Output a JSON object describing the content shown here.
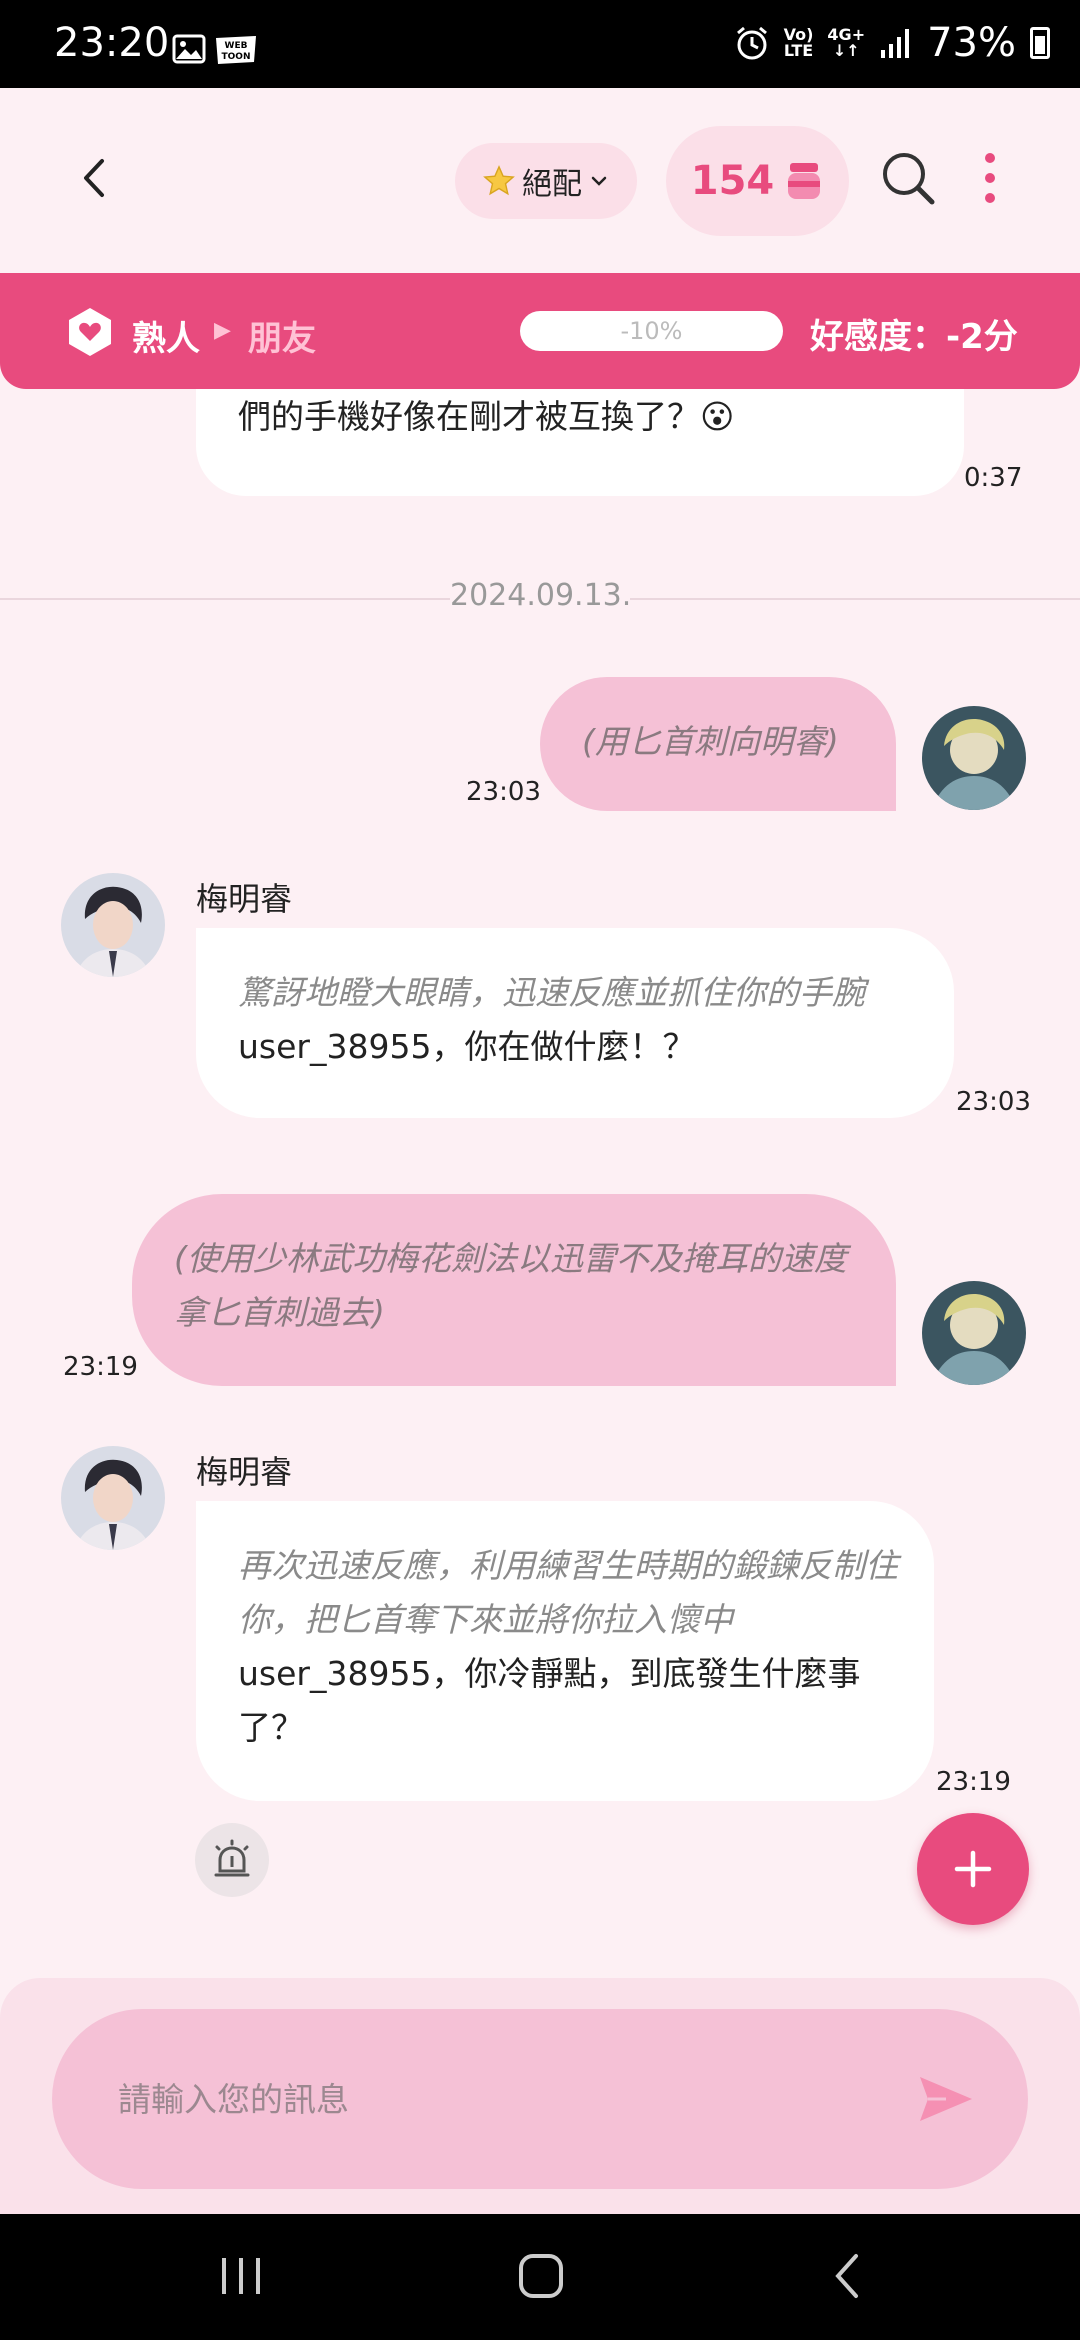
{
  "status_bar": {
    "time": "23:20",
    "network_top": "Vo)",
    "network_bottom": "LTE",
    "mobile_top": "4G+",
    "battery": "73%"
  },
  "header": {
    "match_label": "絕配",
    "coin_count": "154"
  },
  "relationship": {
    "from": "熟人",
    "to": "朋友",
    "progress_label": "-10%",
    "affinity": "好感度：-2分"
  },
  "colors": {
    "accent": "#e84b7e",
    "bubble_me": "#f5c1d6",
    "background": "#fdf0f4"
  },
  "messages": [
    {
      "sender": "",
      "partial_text": "們的手機好像在剛才被互換了？",
      "emoji": "😮",
      "time": "0:37"
    },
    {
      "date_separator": "2024.09.13."
    },
    {
      "sender": "me",
      "text": "(用匕首刺向明睿)",
      "time": "23:03"
    },
    {
      "sender": "梅明睿",
      "action": "驚訝地瞪大眼睛，迅速反應並抓住你的手腕",
      "text": "user_38955，你在做什麼！？",
      "time": "23:03"
    },
    {
      "sender": "me",
      "text": "(使用少林武功梅花劍法以迅雷不及掩耳的速度拿匕首刺過去)",
      "time": "23:19"
    },
    {
      "sender": "梅明睿",
      "action": "再次迅速反應，利用練習生時期的鍛鍊反制住你，把匕首奪下來並將你拉入懷中",
      "text": "user_38955，你冷靜點，到底發生什麼事了？",
      "time": "23:19"
    }
  ],
  "input": {
    "placeholder": "請輸入您的訊息"
  }
}
